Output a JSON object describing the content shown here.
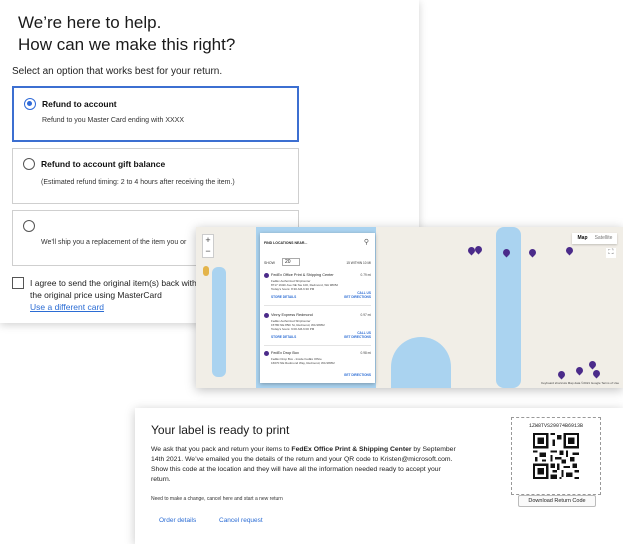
{
  "return_options": {
    "title_line1": "We’re here to help.",
    "title_line2": "How can we make this right?",
    "subtitle": "Select an option that works best for your return.",
    "options": [
      {
        "label": "Refund to account",
        "description": "Refund to you Master Card ending with XXXX",
        "selected": true
      },
      {
        "label": "Refund to account gift balance",
        "description": "(Estimated refund timing: 2 to 4 hours after receiving the item.)",
        "selected": false
      },
      {
        "label": "",
        "description": "We’ll ship you a replacement of the item you or",
        "selected": false
      }
    ],
    "agree_text": "I agree to send the original item(s) back with charged the original price using MasterCard",
    "use_different_card": "Use a different card"
  },
  "map": {
    "panel_title": "FIND LOCATIONS NEAR...",
    "show_label": "SHOW",
    "show_value": "20",
    "within_label": "15 WITHIN 10 MI",
    "map_tab": "Map",
    "satellite_tab": "Satellite",
    "zoom_in": "+",
    "zoom_out": "−",
    "locations": [
      {
        "name": "FedEx Office Print & Shipping Center",
        "distance": "0.79 mi",
        "line1": "FedEx Authorized ShipCenter",
        "line2": "8717 164th Ave NE Ste 100, Redmond, WA 98052",
        "line3": "Today's hours: 8:30 AM-6:30 PM",
        "call": "CALL US",
        "details": "STORE DETAILS",
        "directions": "GET DIRECTIONS"
      },
      {
        "name": "Vinny Express Redmond",
        "distance": "0.97 mi",
        "line1": "FedEx Authorized ShipCenter",
        "line2": "15780 NE 85th St, Redmond, WA 98052",
        "line3": "Today's hours: 9:00 AM-6:00 PM",
        "call": "CALL US",
        "details": "STORE DETAILS",
        "directions": "GET DIRECTIONS"
      },
      {
        "name": "FedEx Drop Box",
        "distance": "0.98 mi",
        "line1": "FedEx Drop Box - Inside FedEx Office",
        "line2": "16670 NE Redmond Way, Redmond, WA 98052",
        "line3": "",
        "call": "",
        "details": "",
        "directions": "GET DIRECTIONS"
      }
    ],
    "footer": "Keyboard shortcuts   Map data ©2021 Google   Terms of Use"
  },
  "label": {
    "title": "Your label is ready to print",
    "body_pre": "We ask that you pack and return your items to ",
    "body_bold": "FedEx Office Print & Shipping Center",
    "body_post": " by September 14th 2021. We’ve emailed you the details of the return and your QR code to Kristen@microsoft.com. Show this code at the location and they will have all the information needed ready to accept your return.",
    "change_text": "Need to make a change, cancel here and start a new return",
    "order_details": "Order details",
    "cancel_request": "Cancel request",
    "code": "1ZW8TVS29074B6913B",
    "download_button": "Download Return Code"
  },
  "colors": {
    "accent": "#2f6ad8",
    "link": "#2b6cd4",
    "pin": "#4b2b8a",
    "water": "#aad3f0",
    "land": "#f1eee7"
  },
  "icons": [
    "search-icon",
    "location-pin-icon",
    "fullscreen-icon",
    "qr-code-icon"
  ]
}
